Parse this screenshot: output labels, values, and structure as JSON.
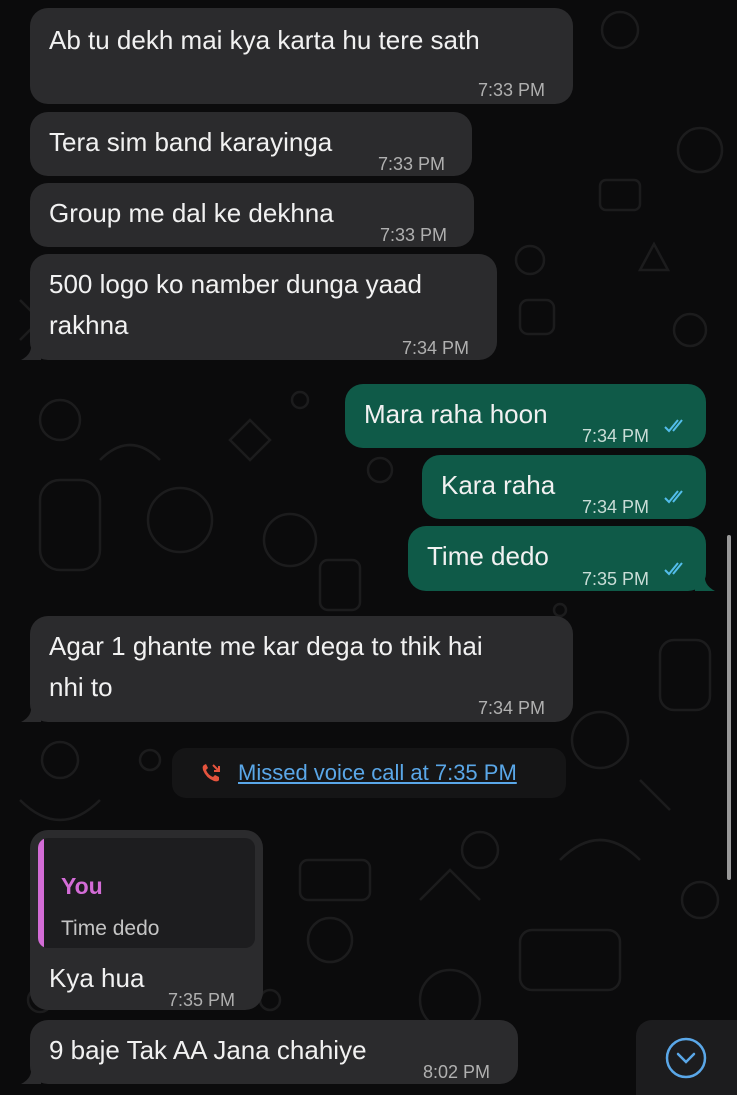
{
  "messages": [
    {
      "text": "Ab tu dekh mai kya karta hu tere sath",
      "time": "7:33 PM"
    },
    {
      "text": "Tera sim band karayinga",
      "time": "7:33 PM"
    },
    {
      "text": "Group me dal ke dekhna",
      "time": "7:33 PM"
    },
    {
      "line1": "500 logo ko namber dunga yaad",
      "line2": "rakhna",
      "time": "7:34 PM"
    },
    {
      "text": "Mara raha hoon",
      "time": "7:34 PM"
    },
    {
      "text": "Kara raha",
      "time": "7:34 PM"
    },
    {
      "text": "Time dedo",
      "time": "7:35 PM"
    },
    {
      "line1": "Agar 1 ghante me kar dega to thik hai",
      "line2": "nhi to",
      "time": "7:34 PM"
    },
    {
      "text": "Kya hua",
      "time": "7:35 PM"
    },
    {
      "text": "9 baje Tak AA Jana chahiye",
      "time": "8:02 PM"
    }
  ],
  "missed_call": {
    "text": "Missed voice call at 7:35 PM",
    "icon": "missed-call-icon"
  },
  "reply_quote": {
    "author": "You",
    "text": "Time dedo"
  },
  "colors": {
    "incoming": "#2b2b2d",
    "outgoing": "#0f5a48",
    "tick": "#53bdeb",
    "quote_accent": "#d36cd6",
    "missed_call": "#e5533d",
    "link": "#5aa7e8"
  }
}
